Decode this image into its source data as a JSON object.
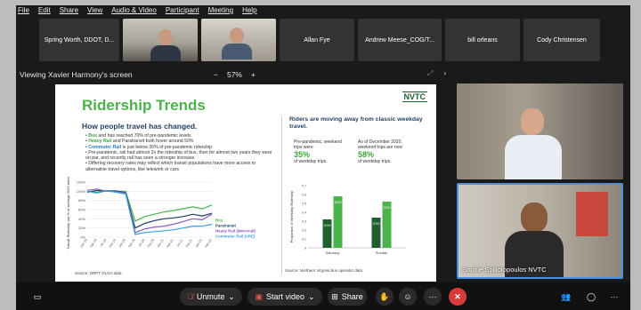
{
  "menu": [
    "File",
    "Edit",
    "Share",
    "View",
    "Audio & Video",
    "Participant",
    "Meeting",
    "Help"
  ],
  "participants": [
    {
      "name": "Spring Worth, DDOT, D..."
    },
    {
      "name": ""
    },
    {
      "name": ""
    },
    {
      "name": "Allan Fye"
    },
    {
      "name": "Andrew Meese_COG/T..."
    },
    {
      "name": "bill orleans"
    },
    {
      "name": "Cody Christensen"
    }
  ],
  "screen": {
    "title": "Viewing Xavier Harmony's screen",
    "zoom_minus": "−",
    "zoom": "57%",
    "zoom_plus": "+"
  },
  "slide": {
    "title": "Ridership Trends",
    "logo": "NVTC",
    "subtitle": "How people travel has changed.",
    "bullets": [
      {
        "lead": "Bus",
        "cls": "g",
        "text": " and has reached 70% of pre-pandemic levels"
      },
      {
        "lead": "Heavy Rail",
        "cls": "gr",
        "text": " and Paratransit both hover around 50%"
      },
      {
        "lead": "Commuter Rail",
        "cls": "bl",
        "text": " is just below 30% of pre-pandemic ridership"
      },
      {
        "lead": "",
        "cls": "",
        "text": "Pre-pandemic, rail had almost 2x the ridership of bus, then for almost two years they were on par, and recently rail has seen a stronger increase."
      },
      {
        "lead": "",
        "cls": "",
        "text": "Differing recovery rates may reflect which transit populations have more access to alternative travel options, like telework or cars"
      }
    ],
    "line_source": "Source: DRPT OLGA data",
    "right_title": "Riders are moving away from classic weekday travel.",
    "stat1_label": "Pre-pandemic, weekend trips were",
    "stat1_value": "35%",
    "stat1_suffix": "of weekday trips.",
    "stat2_label": "As of December 2020, weekend trips are now",
    "stat2_value": "58%",
    "stat2_suffix": "of weekday trips.",
    "bar_source": "Source: Northern Virginia bus operator data"
  },
  "chart_data": [
    {
      "type": "line",
      "ylabel": "Transit Ridership (as % of average 2019 ridership)",
      "ylim": [
        0,
        120
      ],
      "y_ticks": [
        0,
        20,
        40,
        60,
        80,
        100,
        120
      ],
      "categories": [
        "Jan-19",
        "Apr-19",
        "Jul-19",
        "Oct-19",
        "Jan-20",
        "Apr-20",
        "Jul-20",
        "Oct-20",
        "Jan-21",
        "Apr-21",
        "Jul-21",
        "Oct-21",
        "Jan-22",
        "Apr-22"
      ],
      "series": [
        {
          "name": "Bus",
          "color": "#4bb34b",
          "values": [
            100,
            98,
            102,
            100,
            100,
            35,
            45,
            50,
            55,
            58,
            62,
            66,
            62,
            70
          ]
        },
        {
          "name": "Paratransit",
          "color": "#1f3f5f",
          "values": [
            98,
            102,
            100,
            101,
            97,
            20,
            30,
            36,
            40,
            42,
            45,
            50,
            46,
            52
          ]
        },
        {
          "name": "Heavy Rail (Metrorail)",
          "color": "#8a5cc2",
          "values": [
            102,
            105,
            100,
            99,
            96,
            10,
            18,
            22,
            24,
            28,
            34,
            40,
            38,
            50
          ]
        },
        {
          "name": "Commuter Rail (VRE)",
          "color": "#3aa0e0",
          "values": [
            100,
            96,
            101,
            98,
            94,
            6,
            10,
            12,
            14,
            16,
            20,
            24,
            24,
            28
          ]
        }
      ]
    },
    {
      "type": "bar",
      "ylabel": "Proportion of Weekday Ridership",
      "ylim": [
        0,
        0.7
      ],
      "y_ticks": [
        0,
        0.1,
        0.2,
        0.3,
        0.4,
        0.5,
        0.6,
        0.7
      ],
      "categories": [
        "Saturday",
        "Sunday"
      ],
      "series": [
        {
          "name": "2019",
          "color": "#1f5e2f",
          "values": [
            0.32,
            0.34
          ]
        },
        {
          "name": "2020",
          "color": "#4bb34b",
          "values": [
            0.58,
            0.52
          ]
        }
      ]
    }
  ],
  "right_videos": [
    {
      "name": ""
    },
    {
      "name": "Sophie Spiliotopoulos NVTC"
    }
  ],
  "controls": {
    "unmute": "Unmute",
    "start_video": "Start video",
    "share": "Share"
  }
}
